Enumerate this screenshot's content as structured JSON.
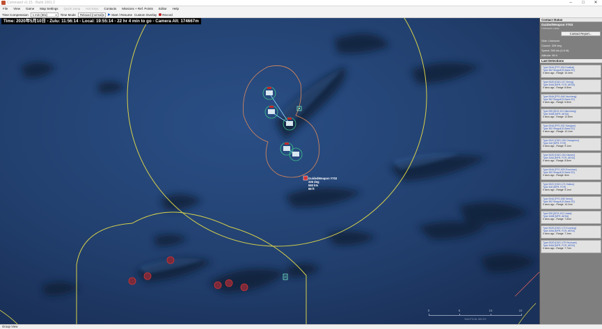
{
  "app": {
    "title": "Command v1.15 - Build 1061.2",
    "window_controls": {
      "minimize": "–",
      "maximize": "□",
      "close": "✕"
    }
  },
  "menu": [
    {
      "label": "File",
      "enabled": true
    },
    {
      "label": "View",
      "enabled": true
    },
    {
      "label": "Game",
      "enabled": true
    },
    {
      "label": "Map Settings",
      "enabled": true
    },
    {
      "label": "Quick Jump",
      "enabled": false
    },
    {
      "label": "Hot Keys",
      "enabled": false
    },
    {
      "label": "Contacts",
      "enabled": true
    },
    {
      "label": "Missions + Ref. Points",
      "enabled": true
    },
    {
      "label": "Editor",
      "enabled": true
    },
    {
      "label": "Help",
      "enabled": true
    }
  ],
  "toolbar": {
    "time_compression_label": "Time Compression",
    "time_compression_value": "1 min (60x)",
    "time_mode_label": "Time Mode",
    "time_mode_value": "Relaxed (normal)",
    "start_resume": "Start / Resume",
    "custom_overlay": "Custom Overlay",
    "record": "Record"
  },
  "map": {
    "time_bar": "Time: 2020年5月10日 - Zulu: 11:56:14 - Local: 19:55:14 - 22 hr 4 min to go -  Camera Alt: 174667m",
    "selected_unit_label": {
      "name": "GuidedWeapon #703",
      "course": "326 deg",
      "speed": "560 kts",
      "altitude": "98 ft"
    },
    "scale": {
      "ticks": [
        "0",
        "5",
        "15",
        "22"
      ],
      "unit": "NAUTICAL MILES"
    },
    "colors": {
      "range_ring": "#d8d24a",
      "threat_ring": "#e08a5a",
      "unit_ring": "#3ec48a",
      "contact_marker": "#d43434"
    }
  },
  "panel": {
    "contact_status": {
      "header": "Contact Status",
      "name": "GuidedWeapon #703",
      "sub": "Unknown class",
      "report_button": "Contact Report...",
      "side": "Side: Unknown",
      "course": "Course: 326 deg",
      "speed": "Speed: 560 kts (0.8 M)",
      "altitude": "Altitude: 98 ft"
    },
    "last_detections": {
      "header": "Last Detections",
      "items": [
        {
          "by": "Type 054A [FFG-542 Huaihai]",
          "on": "Type 382 Seagull [S-Band 2D]",
          "ago": "0 secs ago  - Range: 10.4nm"
        },
        {
          "by": "Type 052D [DDG-117 Xining]",
          "on": "Type 346A [MFR, FCR, AESA]",
          "ago": "0 secs ago  - Range: 8.8nm"
        },
        {
          "by": "Type 054A [FFG-546 Yancheng]",
          "on": "Type 382 Seagull [S-Band 2D]",
          "ago": "0 secs ago  - Range: 6.8nm"
        },
        {
          "by": "Type 055 [DDG-101 Nanchang]",
          "on": "Type 346B [MFR, AESA]",
          "ago": "0 secs ago  - Range: 12.8nm"
        },
        {
          "by": "Type 054A [FFG-531 Xiangtan]",
          "on": "Type 382 Seagull [S-Band 2D]",
          "ago": "0 secs ago  - Range: 12.1nm"
        },
        {
          "by": "Type 052C [DDG-150 Changchun]",
          "on": "Type 346 [MFR, FCR]",
          "ago": "0 secs ago  - Range: 9.1nm"
        },
        {
          "by": "Type 052D [DDG-154 Xiamen]",
          "on": "Type 346A [MFR, FCR, AESA]",
          "ago": "0 secs ago  - Range: 8.8nm"
        },
        {
          "by": "Type 054A [FFG-529 Zhoushan]",
          "on": "Type 382 Seagull [S-Band 2D]",
          "ago": "0 secs ago  - Range: 8nm"
        },
        {
          "by": "Type 052C [DDG-171 Haikou]",
          "on": "Type 346 [MFR, FCR]",
          "ago": "0 secs ago  - Range: 9.1nm"
        },
        {
          "by": "Type 054A [FFG-538 Yantai]",
          "on": "Type 382 Seagull [S-Band 2D]",
          "ago": "0 secs ago  - Range: 10.2nm"
        },
        {
          "by": "Type 055 [DDG-102 Lhasa]",
          "on": "Type 346B [MFR, AESA]",
          "ago": "0 secs ago  - Range: 7.6nm"
        },
        {
          "by": "Type 052D [DDG-172 Kunming]",
          "on": "Type 346A [MFR, FCR, AESA]",
          "ago": "0 secs ago  - Range: 7.1nm"
        },
        {
          "by": "Type 052D [DDG-175 Yinchuan]",
          "on": "Type 346A [MFR, FCR, AESA]",
          "ago": "0 secs ago  - Range: 7.7nm"
        }
      ]
    }
  },
  "status_bar": "Group View"
}
